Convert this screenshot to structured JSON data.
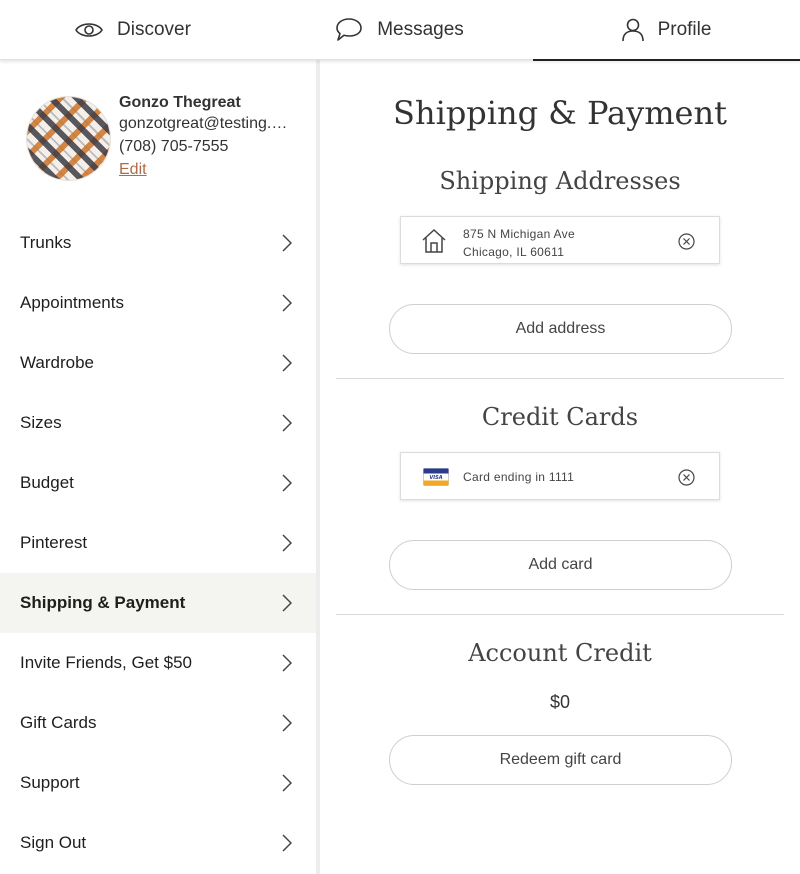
{
  "tabs": {
    "discover": "Discover",
    "messages": "Messages",
    "profile": "Profile"
  },
  "profile": {
    "name": "Gonzo Thegreat",
    "email": "gonzotgreat@testing.com",
    "phone": "(708) 705-7555",
    "edit_label": "Edit"
  },
  "menu": {
    "items": [
      {
        "label": "Trunks"
      },
      {
        "label": "Appointments"
      },
      {
        "label": "Wardrobe"
      },
      {
        "label": "Sizes"
      },
      {
        "label": "Budget"
      },
      {
        "label": "Pinterest"
      },
      {
        "label": "Shipping & Payment",
        "active": true
      },
      {
        "label": "Invite Friends, Get $50"
      },
      {
        "label": "Gift Cards"
      },
      {
        "label": "Support"
      },
      {
        "label": "Sign Out"
      }
    ]
  },
  "main": {
    "title": "Shipping & Payment",
    "shipping": {
      "heading": "Shipping Addresses",
      "address_line1": "875 N Michigan Ave",
      "address_line2": "Chicago, IL 60611",
      "add_label": "Add address"
    },
    "cards": {
      "heading": "Credit Cards",
      "card_label": "Card ending in 1111",
      "card_brand": "VISA",
      "add_label": "Add card"
    },
    "account_credit": {
      "heading": "Account Credit",
      "amount": "$0",
      "redeem_label": "Redeem gift card"
    }
  },
  "icons": {
    "discover": "eye-icon",
    "messages": "speech-bubble-icon",
    "profile": "person-icon",
    "menu_chevron": "chevron-right-icon",
    "address": "house-icon",
    "remove": "close-circle-icon",
    "card": "visa-card-icon"
  },
  "colors": {
    "edit_link": "#b16a48",
    "active_row": "#f4f4f1",
    "visa_blue": "#2a3a8c",
    "visa_gold": "#f0a825"
  }
}
